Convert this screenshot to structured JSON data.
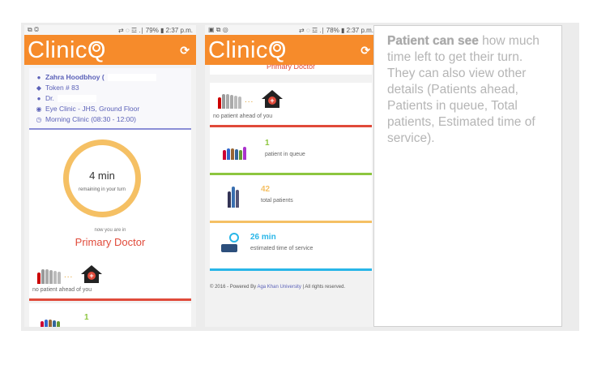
{
  "phone1": {
    "status": {
      "left": "⧉ ◎",
      "right": "⇄ ◌ ☲ .∣ 79% ▮ 2:37 p.m."
    },
    "app": {
      "brand": "Clinic",
      "brand_q": "Q",
      "refresh": "⟳"
    },
    "info": {
      "name": "Zahra Hoodbhoy (",
      "token": "Token # 83",
      "doctor": "Dr.",
      "clinic": "Eye Clinic - JHS, Ground Floor",
      "session": "Morning Clinic (08:30 - 12:00)"
    },
    "timer": {
      "value": "4 min",
      "caption": "remaining in your turn"
    },
    "now_in": "now you are in",
    "station": "Primary Doctor",
    "ahead": {
      "dots": "...",
      "label": "no patient ahead of you"
    },
    "queue_partial": {
      "count": "1"
    }
  },
  "phone2": {
    "status": {
      "left": "▣ ⧉ ◎",
      "right": "⇄ ◌ ☲ .∣ 78% ▮ 2:37 p.m."
    },
    "app": {
      "brand": "Clinic",
      "brand_q": "Q",
      "refresh": "⟳"
    },
    "cut_title": "Primary Doctor",
    "ahead": {
      "dots": "...",
      "label": "no patient ahead of you"
    },
    "queue": {
      "count": "1",
      "label": "patient in queue",
      "color": "#8dc63f"
    },
    "total": {
      "count": "42",
      "label": "total patients",
      "color": "#f5c064"
    },
    "estimate": {
      "value": "26 min",
      "label": "estimated time of service",
      "color": "#29b6e8"
    },
    "footer": {
      "prefix": "© 2016 - Powered By ",
      "uni": "Aga Khan University",
      "suffix": " | All rights reserved."
    }
  },
  "description": {
    "bold": "Patient can see",
    "rest": " how much time left to get their turn. They can also view other details (Patients ahead, Patients in queue, Total patients, Estimated time of service)."
  },
  "colors": {
    "brand_orange": "#f68b2b",
    "accent_blue": "#5b61b8",
    "red": "#e04a3a"
  }
}
